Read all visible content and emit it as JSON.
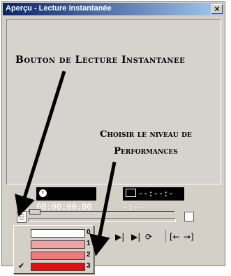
{
  "window": {
    "title": "Aperçu - Lecture instantanée",
    "close_label": "×"
  },
  "annotations": {
    "note1": "Bouton de Lecture Instantanee",
    "note2_line1": "Choisir le niveau de",
    "note2_line2": "Performances"
  },
  "timecodes": {
    "current": "00:00:00:00",
    "selection": "--:--:--:--"
  },
  "controls": {
    "play": "▶|",
    "next": "▶|",
    "loop": "⟳",
    "mark_in": "[←",
    "mark_out": "→]"
  },
  "performance_menu": {
    "items": [
      {
        "level": "0",
        "color": "#ffffff",
        "checked": false
      },
      {
        "level": "1",
        "color": "#f4a0a0",
        "checked": false
      },
      {
        "level": "2",
        "color": "#f07a7a",
        "checked": false
      },
      {
        "level": "3",
        "color": "#e01010",
        "checked": true
      }
    ],
    "check_glyph": "✔"
  }
}
